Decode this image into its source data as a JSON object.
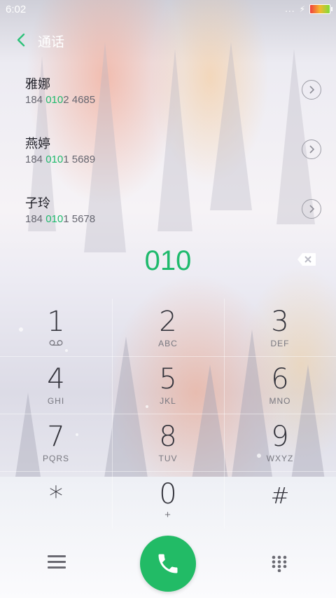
{
  "status": {
    "time": "6:02",
    "dots": "...",
    "bolt": "⚡"
  },
  "topbar": {
    "title": "通话"
  },
  "contacts": [
    {
      "name": "雅娜",
      "pre": "184 ",
      "match": "010",
      "post": "2 4685"
    },
    {
      "name": "燕婷",
      "pre": "184 ",
      "match": "010",
      "post": "1 5689"
    },
    {
      "name": "子玲",
      "pre": "184 ",
      "match": "010",
      "post": "1 5678"
    }
  ],
  "dialer": {
    "number": "010"
  },
  "keys": [
    {
      "digit": "1",
      "letters": ""
    },
    {
      "digit": "2",
      "letters": "ABC"
    },
    {
      "digit": "3",
      "letters": "DEF"
    },
    {
      "digit": "4",
      "letters": "GHI"
    },
    {
      "digit": "5",
      "letters": "JKL"
    },
    {
      "digit": "6",
      "letters": "MNO"
    },
    {
      "digit": "7",
      "letters": "PQRS"
    },
    {
      "digit": "8",
      "letters": "TUV"
    },
    {
      "digit": "9",
      "letters": "WXYZ"
    },
    {
      "digit": "*",
      "letters": ""
    },
    {
      "digit": "0",
      "letters": "+"
    },
    {
      "digit": "#",
      "letters": ""
    }
  ],
  "icons": {
    "back": "chevron-left-icon",
    "detail": "chevron-right-circle-icon",
    "backspace": "backspace-icon",
    "voicemail": "voicemail-icon",
    "menu": "menu-icon",
    "call": "phone-icon",
    "keypad": "dialpad-icon"
  },
  "colors": {
    "accent": "#1fba6d",
    "call_button": "#22bb66"
  }
}
